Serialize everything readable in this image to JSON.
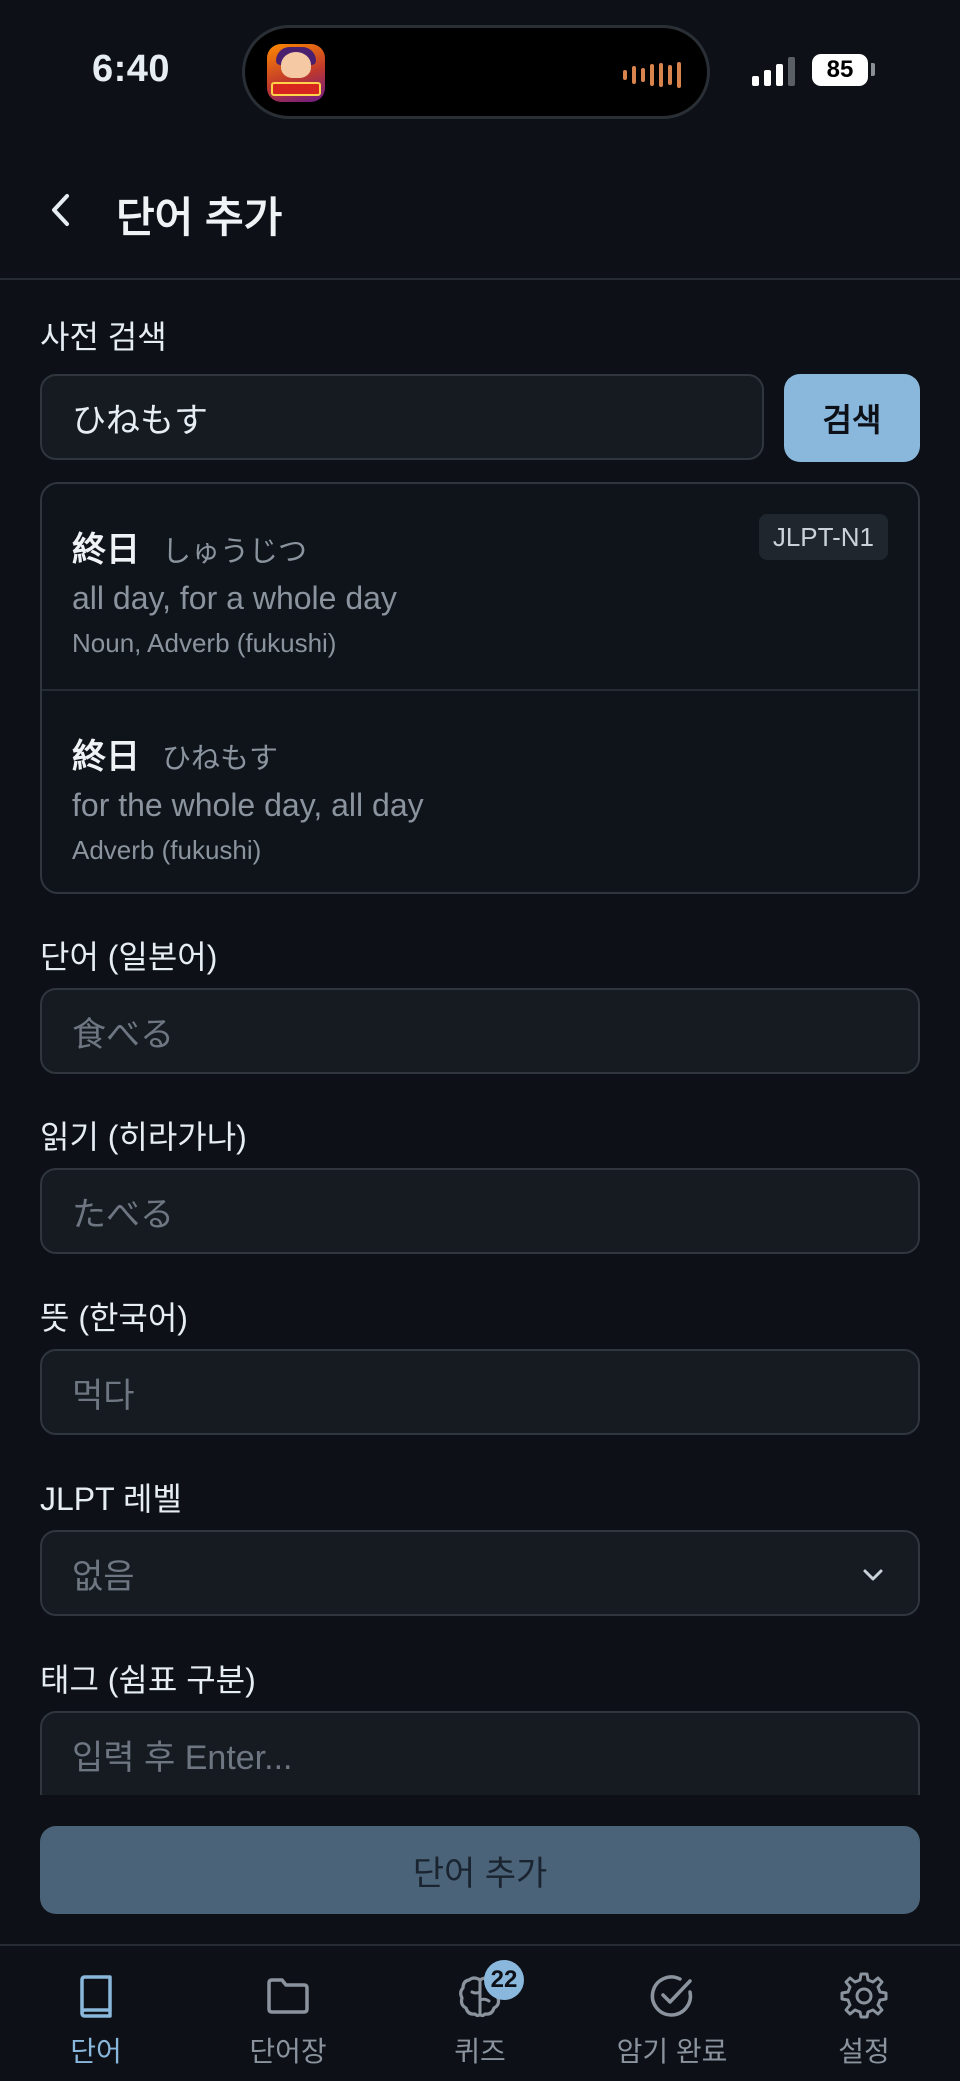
{
  "status_bar": {
    "time": "6:40",
    "battery": "85"
  },
  "header": {
    "title": "단어 추가"
  },
  "dictionary_search": {
    "label": "사전 검색",
    "value": "ひねもす",
    "button_label": "검색"
  },
  "results": [
    {
      "word": "終日",
      "reading": "しゅうじつ",
      "meaning": "all day, for a whole day",
      "pos": "Noun, Adverb (fukushi)",
      "jlpt": "JLPT-N1"
    },
    {
      "word": "終日",
      "reading": "ひねもす",
      "meaning": "for the whole day, all day",
      "pos": "Adverb (fukushi)",
      "jlpt": ""
    }
  ],
  "form": {
    "word_label": "단어 (일본어)",
    "word_placeholder": "食べる",
    "reading_label": "읽기 (히라가나)",
    "reading_placeholder": "たべる",
    "meaning_label": "뜻 (한국어)",
    "meaning_placeholder": "먹다",
    "jlpt_label": "JLPT 레벨",
    "jlpt_value": "없음",
    "tags_label": "태그 (쉼표 구분)",
    "tags_placeholder": "입력 후 Enter...",
    "submit_label": "단어 추가"
  },
  "tabbar": {
    "items": [
      {
        "label": "단어",
        "icon": "book-icon"
      },
      {
        "label": "단어장",
        "icon": "folder-icon"
      },
      {
        "label": "퀴즈",
        "icon": "brain-icon",
        "badge": "22"
      },
      {
        "label": "암기 완료",
        "icon": "check-circle-icon"
      },
      {
        "label": "설정",
        "icon": "gear-icon"
      }
    ]
  },
  "colors": {
    "accent": "#8ab7dc",
    "background": "#0d1117"
  }
}
